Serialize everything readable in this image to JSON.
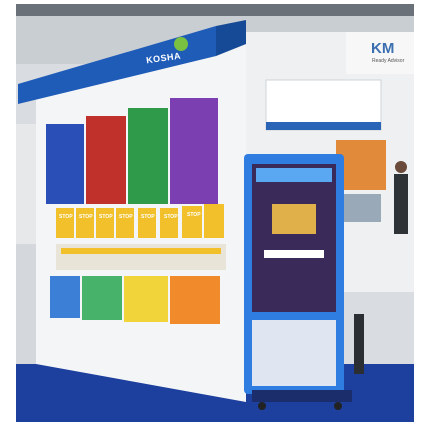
{
  "scene": {
    "description_colors": {
      "booth_blue": "#1f5cb8",
      "floor_blue": "#1d3f9e",
      "panel_white": "#f4f5f7",
      "stop_yellow": "#f2c02a",
      "stop_red": "#d8302e"
    },
    "kosha_logo": "KOSHA",
    "km_logo": "KM",
    "km_sub": "Ready Advisor",
    "stop_badges": [
      "STOP",
      "STOP",
      "STOP",
      "STOP",
      "STOP",
      "STOP",
      "STOP"
    ],
    "kiosk_screen_top": "",
    "kiosk_screen_title": "",
    "kiosk_screen_caption": "",
    "kiosk_banner": "",
    "panel_slogan": "",
    "booth2_logo": "",
    "booth2_logo_b": ""
  }
}
